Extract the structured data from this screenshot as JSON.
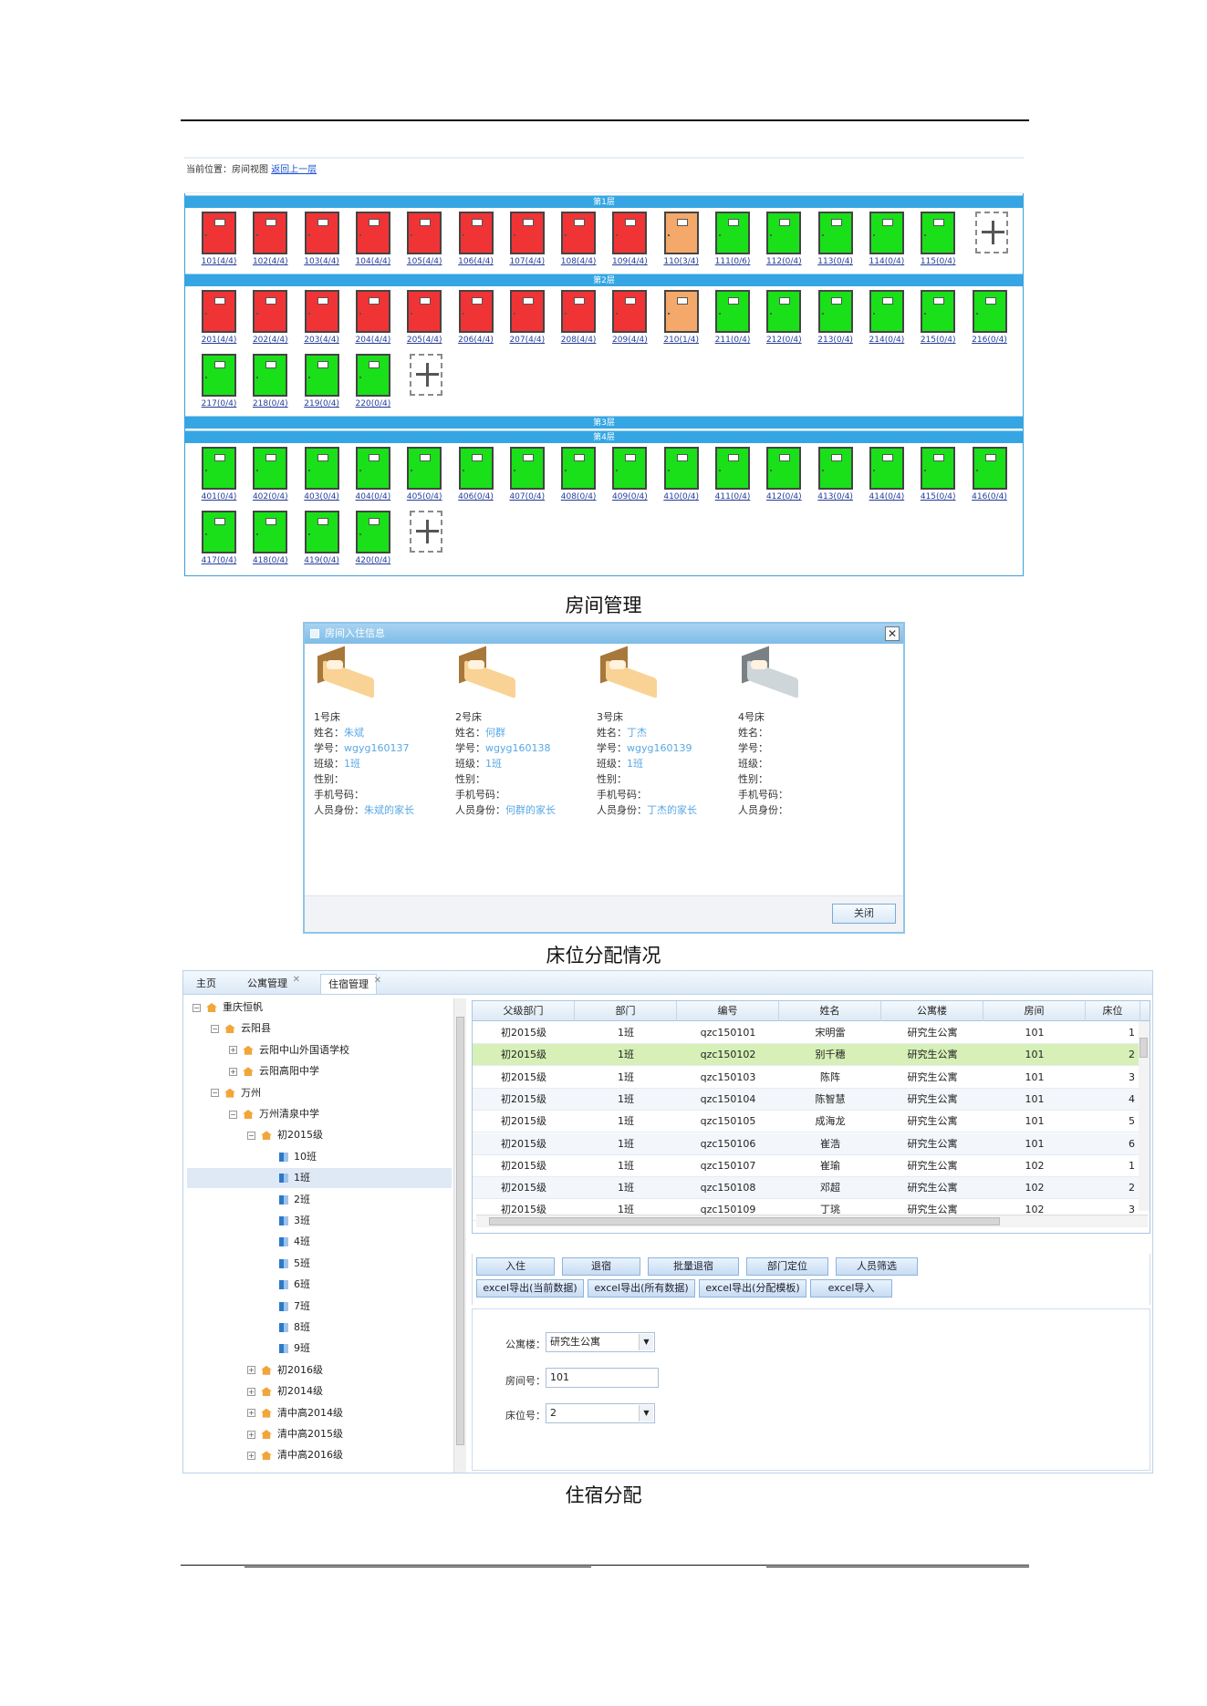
{
  "captions": {
    "room_mgmt": "房间管理",
    "bed_alloc": "床位分配情况",
    "accommodation": "住宿分配"
  },
  "p1": {
    "location_label": "当前位置：房间视图",
    "back_link": "返回上一层",
    "floors": [
      {
        "name": "第1层",
        "rooms": [
          {
            "label": "101(4/4)",
            "status": "full"
          },
          {
            "label": "102(4/4)",
            "status": "full"
          },
          {
            "label": "103(4/4)",
            "status": "full"
          },
          {
            "label": "104(4/4)",
            "status": "full"
          },
          {
            "label": "105(4/4)",
            "status": "full"
          },
          {
            "label": "106(4/4)",
            "status": "full"
          },
          {
            "label": "107(4/4)",
            "status": "full"
          },
          {
            "label": "108(4/4)",
            "status": "full"
          },
          {
            "label": "109(4/4)",
            "status": "full"
          },
          {
            "label": "110(3/4)",
            "status": "partial"
          },
          {
            "label": "111(0/6)",
            "status": "empty"
          },
          {
            "label": "112(0/4)",
            "status": "empty"
          },
          {
            "label": "113(0/4)",
            "status": "empty"
          },
          {
            "label": "114(0/4)",
            "status": "empty"
          },
          {
            "label": "115(0/4)",
            "status": "empty"
          }
        ]
      },
      {
        "name": "第2层",
        "rooms": [
          {
            "label": "201(4/4)",
            "status": "full"
          },
          {
            "label": "202(4/4)",
            "status": "full"
          },
          {
            "label": "203(4/4)",
            "status": "full"
          },
          {
            "label": "204(4/4)",
            "status": "full"
          },
          {
            "label": "205(4/4)",
            "status": "full"
          },
          {
            "label": "206(4/4)",
            "status": "full"
          },
          {
            "label": "207(4/4)",
            "status": "full"
          },
          {
            "label": "208(4/4)",
            "status": "full"
          },
          {
            "label": "209(4/4)",
            "status": "full"
          },
          {
            "label": "210(1/4)",
            "status": "partial"
          },
          {
            "label": "211(0/4)",
            "status": "empty"
          },
          {
            "label": "212(0/4)",
            "status": "empty"
          },
          {
            "label": "213(0/4)",
            "status": "empty"
          },
          {
            "label": "214(0/4)",
            "status": "empty"
          },
          {
            "label": "215(0/4)",
            "status": "empty"
          },
          {
            "label": "216(0/4)",
            "status": "empty"
          },
          {
            "label": "217(0/4)",
            "status": "empty"
          },
          {
            "label": "218(0/4)",
            "status": "empty"
          },
          {
            "label": "219(0/4)",
            "status": "empty"
          },
          {
            "label": "220(0/4)",
            "status": "empty"
          }
        ]
      },
      {
        "name": "第3层",
        "rooms": []
      },
      {
        "name": "第4层",
        "rooms": [
          {
            "label": "401(0/4)",
            "status": "empty"
          },
          {
            "label": "402(0/4)",
            "status": "empty"
          },
          {
            "label": "403(0/4)",
            "status": "empty"
          },
          {
            "label": "404(0/4)",
            "status": "empty"
          },
          {
            "label": "405(0/4)",
            "status": "empty"
          },
          {
            "label": "406(0/4)",
            "status": "empty"
          },
          {
            "label": "407(0/4)",
            "status": "empty"
          },
          {
            "label": "408(0/4)",
            "status": "empty"
          },
          {
            "label": "409(0/4)",
            "status": "empty"
          },
          {
            "label": "410(0/4)",
            "status": "empty"
          },
          {
            "label": "411(0/4)",
            "status": "empty"
          },
          {
            "label": "412(0/4)",
            "status": "empty"
          },
          {
            "label": "413(0/4)",
            "status": "empty"
          },
          {
            "label": "414(0/4)",
            "status": "empty"
          },
          {
            "label": "415(0/4)",
            "status": "empty"
          },
          {
            "label": "416(0/4)",
            "status": "empty"
          },
          {
            "label": "417(0/4)",
            "status": "empty"
          },
          {
            "label": "418(0/4)",
            "status": "empty"
          },
          {
            "label": "419(0/4)",
            "status": "empty"
          },
          {
            "label": "420(0/4)",
            "status": "empty"
          }
        ]
      }
    ],
    "colors": {
      "full": "#f03436",
      "partial": "#f4a96a",
      "empty": "#19e019"
    }
  },
  "p2": {
    "title": "房间入住信息",
    "field_labels": {
      "name": "姓名：",
      "sid": "学号：",
      "cls": "班级：",
      "sex": "性别：",
      "phone": "手机号码：",
      "role": "人员身份："
    },
    "beds": [
      {
        "bed": "1号床",
        "name": "朱斌",
        "sid": "wgyg160137",
        "cls": "1班",
        "sex": "",
        "phone": "",
        "role": "朱斌的家长"
      },
      {
        "bed": "2号床",
        "name": "何群",
        "sid": "wgyg160138",
        "cls": "1班",
        "sex": "",
        "phone": "",
        "role": "何群的家长"
      },
      {
        "bed": "3号床",
        "name": "丁杰",
        "sid": "wgyg160139",
        "cls": "1班",
        "sex": "",
        "phone": "",
        "role": "丁杰的家长"
      },
      {
        "bed": "4号床",
        "name": "",
        "sid": "",
        "cls": "",
        "sex": "",
        "phone": "",
        "role": ""
      }
    ],
    "close_label": "关闭"
  },
  "p3": {
    "tabs": [
      {
        "label": "主页"
      },
      {
        "label": "公寓管理"
      },
      {
        "label": "住宿管理"
      }
    ],
    "tree": [
      {
        "label": "重庆恒帆",
        "level": 0,
        "type": "org",
        "pm": "⊟"
      },
      {
        "label": "云阳县",
        "level": 1,
        "type": "org",
        "pm": "⊟"
      },
      {
        "label": "云阳中山外国语学校",
        "level": 2,
        "type": "org",
        "pm": "⊞"
      },
      {
        "label": "云阳高阳中学",
        "level": 2,
        "type": "org",
        "pm": "⊞"
      },
      {
        "label": "万州",
        "level": 1,
        "type": "org",
        "pm": "⊟"
      },
      {
        "label": "万州清泉中学",
        "level": 2,
        "type": "org",
        "pm": "⊟"
      },
      {
        "label": "初2015级",
        "level": 3,
        "type": "org",
        "pm": "⊟"
      },
      {
        "label": "10班",
        "level": 4,
        "type": "cls",
        "pm": ""
      },
      {
        "label": "1班",
        "level": 4,
        "type": "cls",
        "pm": ""
      },
      {
        "label": "2班",
        "level": 4,
        "type": "cls",
        "pm": ""
      },
      {
        "label": "3班",
        "level": 4,
        "type": "cls",
        "pm": ""
      },
      {
        "label": "4班",
        "level": 4,
        "type": "cls",
        "pm": ""
      },
      {
        "label": "5班",
        "level": 4,
        "type": "cls",
        "pm": ""
      },
      {
        "label": "6班",
        "level": 4,
        "type": "cls",
        "pm": ""
      },
      {
        "label": "7班",
        "level": 4,
        "type": "cls",
        "pm": ""
      },
      {
        "label": "8班",
        "level": 4,
        "type": "cls",
        "pm": ""
      },
      {
        "label": "9班",
        "level": 4,
        "type": "cls",
        "pm": ""
      },
      {
        "label": "初2016级",
        "level": 3,
        "type": "org",
        "pm": "⊞"
      },
      {
        "label": "初2014级",
        "level": 3,
        "type": "org",
        "pm": "⊞"
      },
      {
        "label": "清中高2014级",
        "level": 3,
        "type": "org",
        "pm": "⊞"
      },
      {
        "label": "清中高2015级",
        "level": 3,
        "type": "org",
        "pm": "⊞"
      },
      {
        "label": "清中高2016级",
        "level": 3,
        "type": "org",
        "pm": "⊞"
      }
    ],
    "columns": [
      "父级部门",
      "部门",
      "编号",
      "姓名",
      "公寓楼",
      "房间",
      "床位"
    ],
    "rows": [
      [
        "初2015级",
        "1班",
        "qzc150101",
        "宋明雷",
        "研究生公寓",
        "101",
        "1"
      ],
      [
        "初2015级",
        "1班",
        "qzc150102",
        "别千穗",
        "研究生公寓",
        "101",
        "2"
      ],
      [
        "初2015级",
        "1班",
        "qzc150103",
        "陈阵",
        "研究生公寓",
        "101",
        "3"
      ],
      [
        "初2015级",
        "1班",
        "qzc150104",
        "陈智慧",
        "研究生公寓",
        "101",
        "4"
      ],
      [
        "初2015级",
        "1班",
        "qzc150105",
        "成海龙",
        "研究生公寓",
        "101",
        "5"
      ],
      [
        "初2015级",
        "1班",
        "qzc150106",
        "崔浩",
        "研究生公寓",
        "101",
        "6"
      ],
      [
        "初2015级",
        "1班",
        "qzc150107",
        "崔瑜",
        "研究生公寓",
        "102",
        "1"
      ],
      [
        "初2015级",
        "1班",
        "qzc150108",
        "邓超",
        "研究生公寓",
        "102",
        "2"
      ],
      [
        "初2015级",
        "1班",
        "qzc150109",
        "丁珧",
        "研究生公寓",
        "102",
        "3"
      ]
    ],
    "buttons_row1": [
      "入住",
      "退宿",
      "批量退宿",
      "部门定位",
      "人员筛选"
    ],
    "buttons_row2": [
      "excel导出(当前数据)",
      "excel导出(所有数据)",
      "excel导出(分配模板)",
      "excel导入"
    ],
    "form": {
      "building_label": "公寓楼：",
      "building_value": "研究生公寓",
      "room_label": "房间号：",
      "room_value": "101",
      "bed_label": "床位号：",
      "bed_value": "2"
    }
  }
}
